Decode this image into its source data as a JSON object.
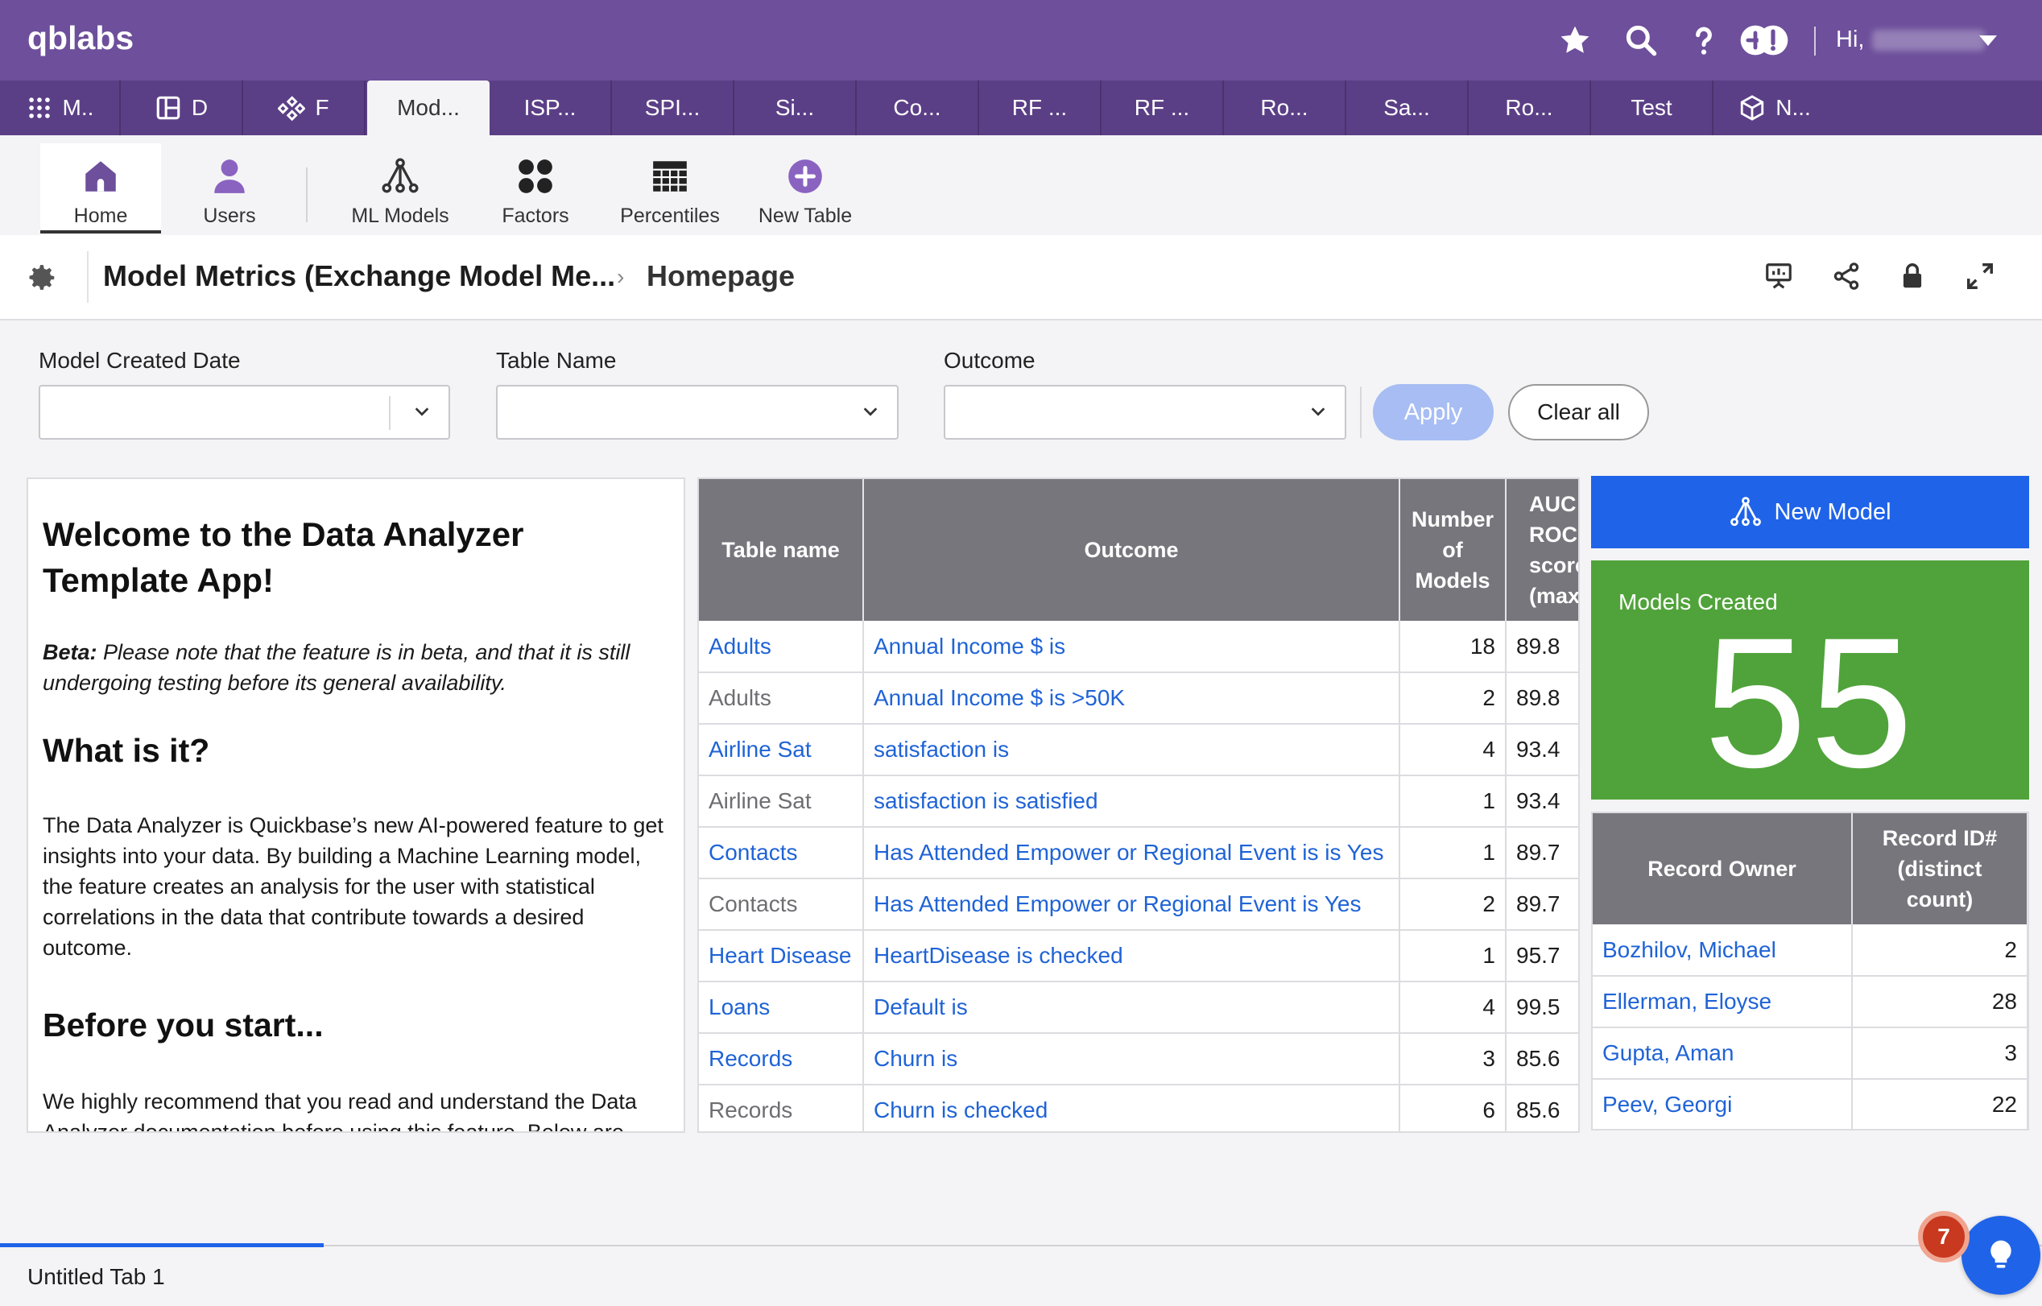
{
  "app": {
    "logo": "qblabs",
    "greeting": "Hi,",
    "colors": {
      "topbar": "#6d4f9b",
      "appbar": "#5b3f86",
      "accent": "#1f63e8",
      "kpi": "#50a33a",
      "link": "#1f63d6"
    }
  },
  "top_icons": [
    "plus-circle-icon",
    "star-icon",
    "search-icon",
    "help-icon",
    "alert-icon"
  ],
  "app_tabs": [
    {
      "label": "M..",
      "icon": "grid-icon"
    },
    {
      "label": "D",
      "icon": "dashboard-icon"
    },
    {
      "label": "F",
      "icon": "pipeline-icon"
    },
    {
      "label": "Mod...",
      "active": true
    },
    {
      "label": "ISP..."
    },
    {
      "label": "SPI..."
    },
    {
      "label": "Si..."
    },
    {
      "label": "Co..."
    },
    {
      "label": "RF ..."
    },
    {
      "label": "RF ..."
    },
    {
      "label": "Ro..."
    },
    {
      "label": "Sa..."
    },
    {
      "label": "Ro..."
    },
    {
      "label": "Test"
    },
    {
      "label": "N...",
      "icon": "cube-icon"
    }
  ],
  "page_nav": [
    {
      "label": "Home",
      "icon": "home-icon",
      "active": true
    },
    {
      "label": "Users",
      "icon": "user-icon"
    },
    {
      "label": "ML Models",
      "icon": "ml-model-icon"
    },
    {
      "label": "Factors",
      "icon": "factors-icon"
    },
    {
      "label": "Percentiles",
      "icon": "table-icon"
    },
    {
      "label": "New Table",
      "icon": "plus-circle-icon"
    }
  ],
  "breadcrumb": {
    "app": "Model Metrics (Exchange Model Me...",
    "page": "Homepage",
    "separator": "›"
  },
  "filters": {
    "model_created_date": {
      "label": "Model Created Date",
      "value": ""
    },
    "table_name": {
      "label": "Table Name",
      "value": ""
    },
    "outcome": {
      "label": "Outcome",
      "value": ""
    },
    "apply_label": "Apply",
    "clear_label": "Clear all"
  },
  "welcome": {
    "title": "Welcome to the Data Analyzer Template App!",
    "beta_label": "Beta:",
    "beta_text": " Please note that the feature is in beta, and that it is still undergoing testing before its general availability.",
    "what_heading": "What is it?",
    "what_text": "The Data Analyzer is Quickbase’s new AI-powered feature to get insights into your data. By building a Machine Learning model, the feature creates an analysis for the user with statistical correlations in the data that contribute towards a desired outcome.",
    "before_heading": "Before you start...",
    "before_text": "We highly recommend that you read and understand the Data Analyzer documentation before using this feature. Below are links to the help articles:"
  },
  "models_table": {
    "headers": [
      "Table name",
      "Outcome",
      "Number of Models",
      "AUC ROC score (max"
    ],
    "rows": [
      {
        "table": "Adults",
        "table_link": true,
        "outcome": "Annual Income $ is",
        "count": "18",
        "auc": "89.8"
      },
      {
        "table": "Adults",
        "table_link": false,
        "outcome": "Annual Income $ is >50K",
        "count": "2",
        "auc": "89.8"
      },
      {
        "table": "Airline Sat",
        "table_link": true,
        "outcome": "satisfaction is",
        "count": "4",
        "auc": "93.4"
      },
      {
        "table": "Airline Sat",
        "table_link": false,
        "outcome": "satisfaction is satisfied",
        "count": "1",
        "auc": "93.4"
      },
      {
        "table": "Contacts",
        "table_link": true,
        "outcome": "Has Attended Empower or Regional Event is is Yes",
        "count": "1",
        "auc": "89.7"
      },
      {
        "table": "Contacts",
        "table_link": false,
        "outcome": "Has Attended Empower or Regional Event is Yes",
        "count": "2",
        "auc": "89.7"
      },
      {
        "table": "Heart Disease",
        "table_link": true,
        "outcome": "HeartDisease is checked",
        "count": "1",
        "auc": "95.7"
      },
      {
        "table": "Loans",
        "table_link": true,
        "outcome": "Default is",
        "count": "4",
        "auc": "99.5"
      },
      {
        "table": "Records",
        "table_link": true,
        "outcome": "Churn is",
        "count": "3",
        "auc": "85.6"
      },
      {
        "table": "Records",
        "table_link": false,
        "outcome": "Churn is checked",
        "count": "6",
        "auc": "85.6"
      }
    ]
  },
  "new_model_label": "New Model",
  "kpi": {
    "label": "Models Created",
    "value": "55"
  },
  "owners_table": {
    "headers": [
      "Record Owner",
      "Record ID# (distinct count)"
    ],
    "rows": [
      {
        "owner": "Bozhilov, Michael",
        "count": "2"
      },
      {
        "owner": "Ellerman, Eloyse",
        "count": "28"
      },
      {
        "owner": "Gupta, Aman",
        "count": "3"
      },
      {
        "owner": "Peev, Georgi",
        "count": "22"
      }
    ]
  },
  "bottom_tab": "Untitled Tab 1",
  "help_badge": "7"
}
